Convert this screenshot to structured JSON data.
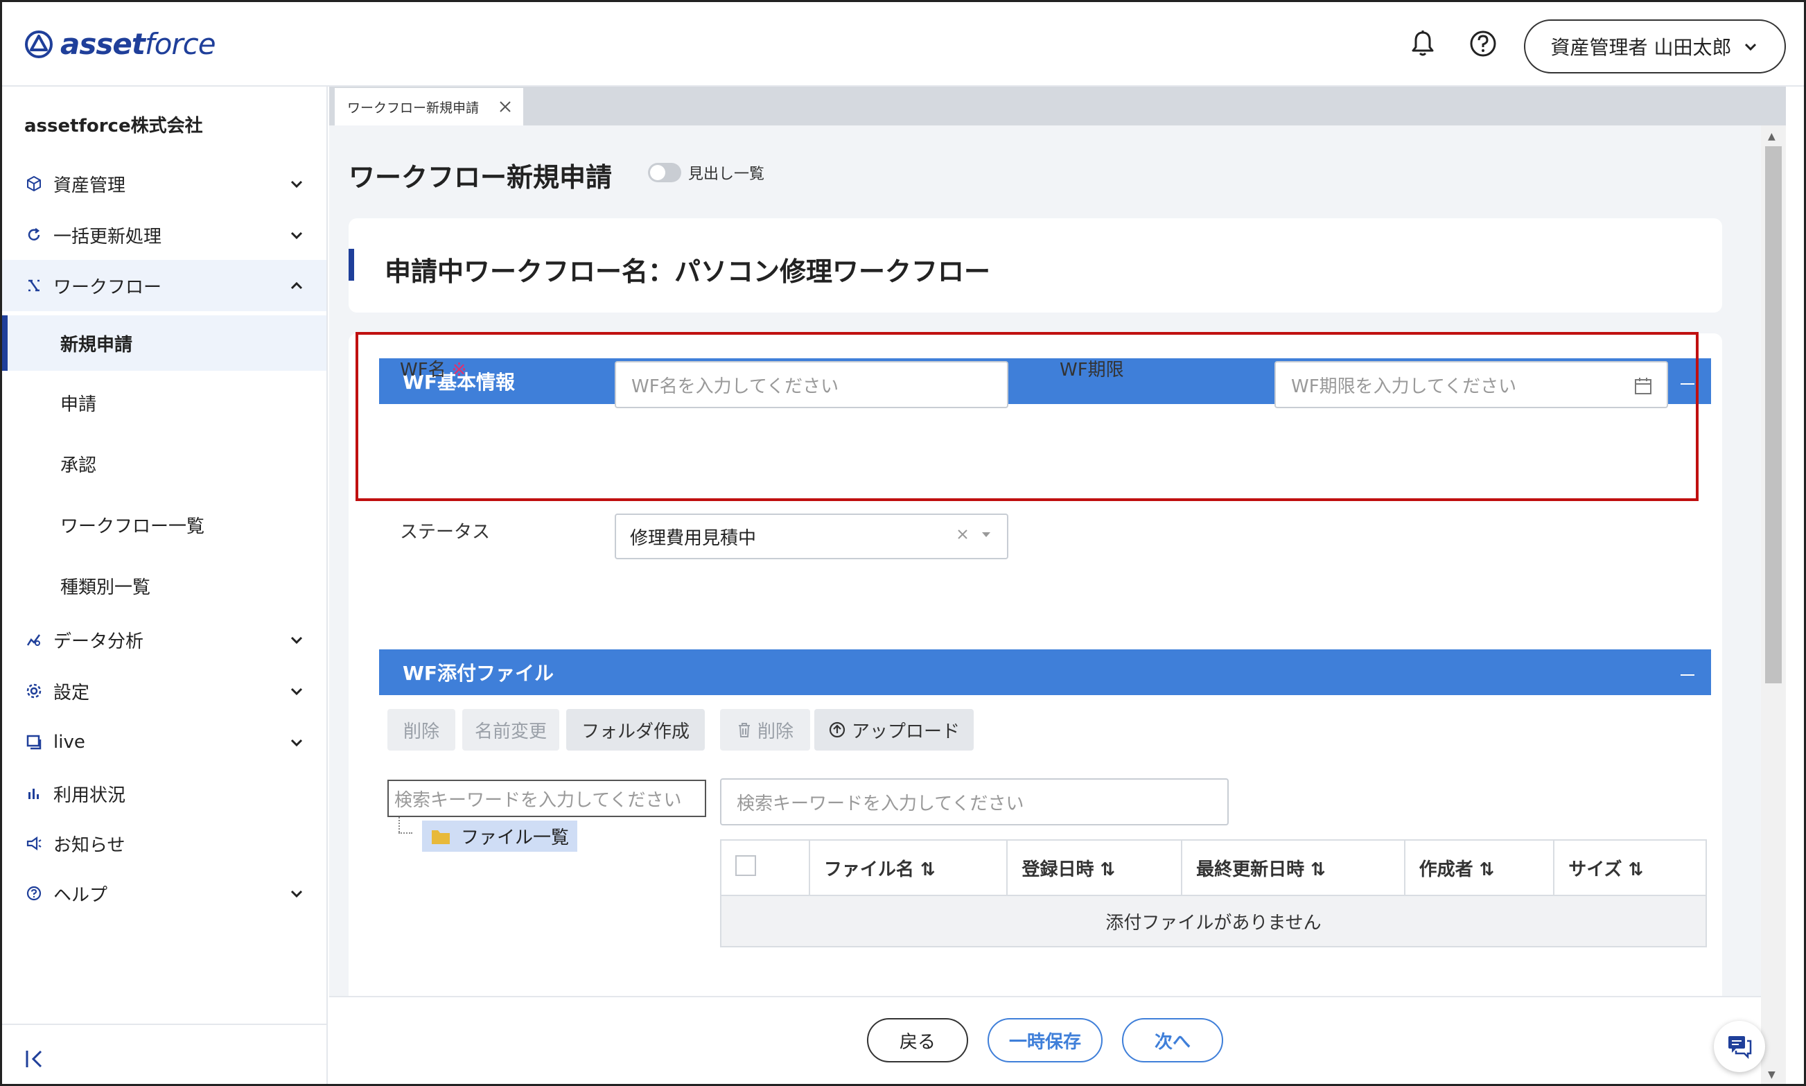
{
  "app": {
    "logo_text_bold": "asset",
    "logo_text_light": "force",
    "user_label": "資産管理者 山田太郎"
  },
  "sidebar": {
    "company": "assetforce株式会社",
    "items": [
      {
        "label": "資産管理",
        "icon": "cube-icon"
      },
      {
        "label": "一括更新処理",
        "icon": "refresh-icon"
      },
      {
        "label": "ワークフロー",
        "icon": "workflow-icon"
      },
      {
        "label": "データ分析",
        "icon": "analytics-icon"
      },
      {
        "label": "設定",
        "icon": "gear-icon"
      },
      {
        "label": "live",
        "icon": "live-icon"
      },
      {
        "label": "利用状況",
        "icon": "bar-chart-icon"
      },
      {
        "label": "お知らせ",
        "icon": "megaphone-icon"
      },
      {
        "label": "ヘルプ",
        "icon": "help-icon"
      }
    ],
    "workflow_sub": [
      "新規申請",
      "申請",
      "承認",
      "ワークフロー一覧",
      "種類別一覧"
    ]
  },
  "tab": {
    "label": "ワークフロー新規申請"
  },
  "page": {
    "title": "ワークフロー新規申請",
    "toggle_label": "見出し一覧",
    "wf_name_heading": "申請中ワークフロー名：パソコン修理ワークフロー"
  },
  "basic_info": {
    "section_title": "WF基本情報",
    "wf_name_label": "WF名",
    "required_mark": "※",
    "wf_name_placeholder": "WF名を入力してください",
    "deadline_label": "WF期限",
    "deadline_placeholder": "WF期限を入力してください",
    "status_label": "ステータス",
    "status_value": "修理費用見積中"
  },
  "attachments": {
    "section_title": "WF添付ファイル",
    "buttons": {
      "delete": "削除",
      "rename": "名前変更",
      "create_folder": "フォルダ作成",
      "delete2": "削除",
      "upload": "アップロード"
    },
    "tree_search_placeholder": "検索キーワードを入力してください",
    "tree_root": "ファイル一覧",
    "file_search_placeholder": "検索キーワードを入力してください",
    "columns": [
      "ファイル名",
      "登録日時",
      "最終更新日時",
      "作成者",
      "サイズ"
    ],
    "empty_message": "添付ファイルがありません"
  },
  "footer": {
    "back": "戻る",
    "save": "一時保存",
    "next": "次へ"
  },
  "colors": {
    "brand": "#1f3f9a",
    "section_header": "#3f7fd9",
    "highlight_border": "#c01010"
  }
}
